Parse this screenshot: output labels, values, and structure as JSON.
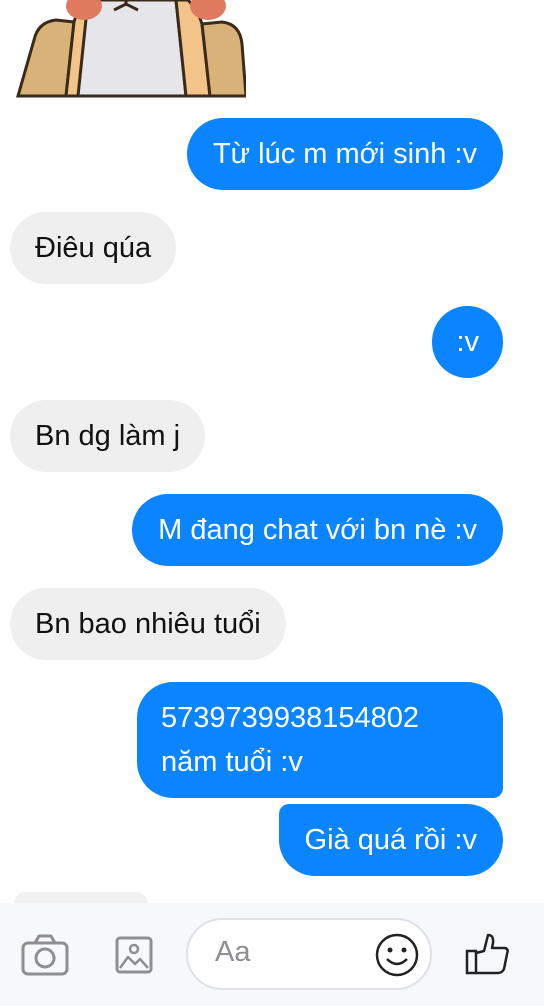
{
  "messages": [
    {
      "side": "out",
      "text": "Từ lúc m mới sinh :v"
    },
    {
      "side": "in",
      "text": "Điêu qúa"
    },
    {
      "side": "out",
      "text": ":v"
    },
    {
      "side": "in",
      "text": "Bn dg làm j"
    },
    {
      "side": "out",
      "text": "M đang chat với bn nè :v"
    },
    {
      "side": "in",
      "text": "Bn bao nhiêu tuổi"
    },
    {
      "side": "out",
      "line1": "5739739938154802",
      "line2": "năm tuổi :v"
    },
    {
      "side": "out",
      "text": "Già quá rồi :v"
    }
  ],
  "composer": {
    "placeholder": "Aa",
    "icons": [
      "camera-icon",
      "image-icon",
      "emoji-icon",
      "thumbs-up-icon"
    ]
  },
  "colors": {
    "outgoing": "#0a84ff",
    "incoming": "#efefef",
    "composer_bg": "#f6f8fb"
  }
}
